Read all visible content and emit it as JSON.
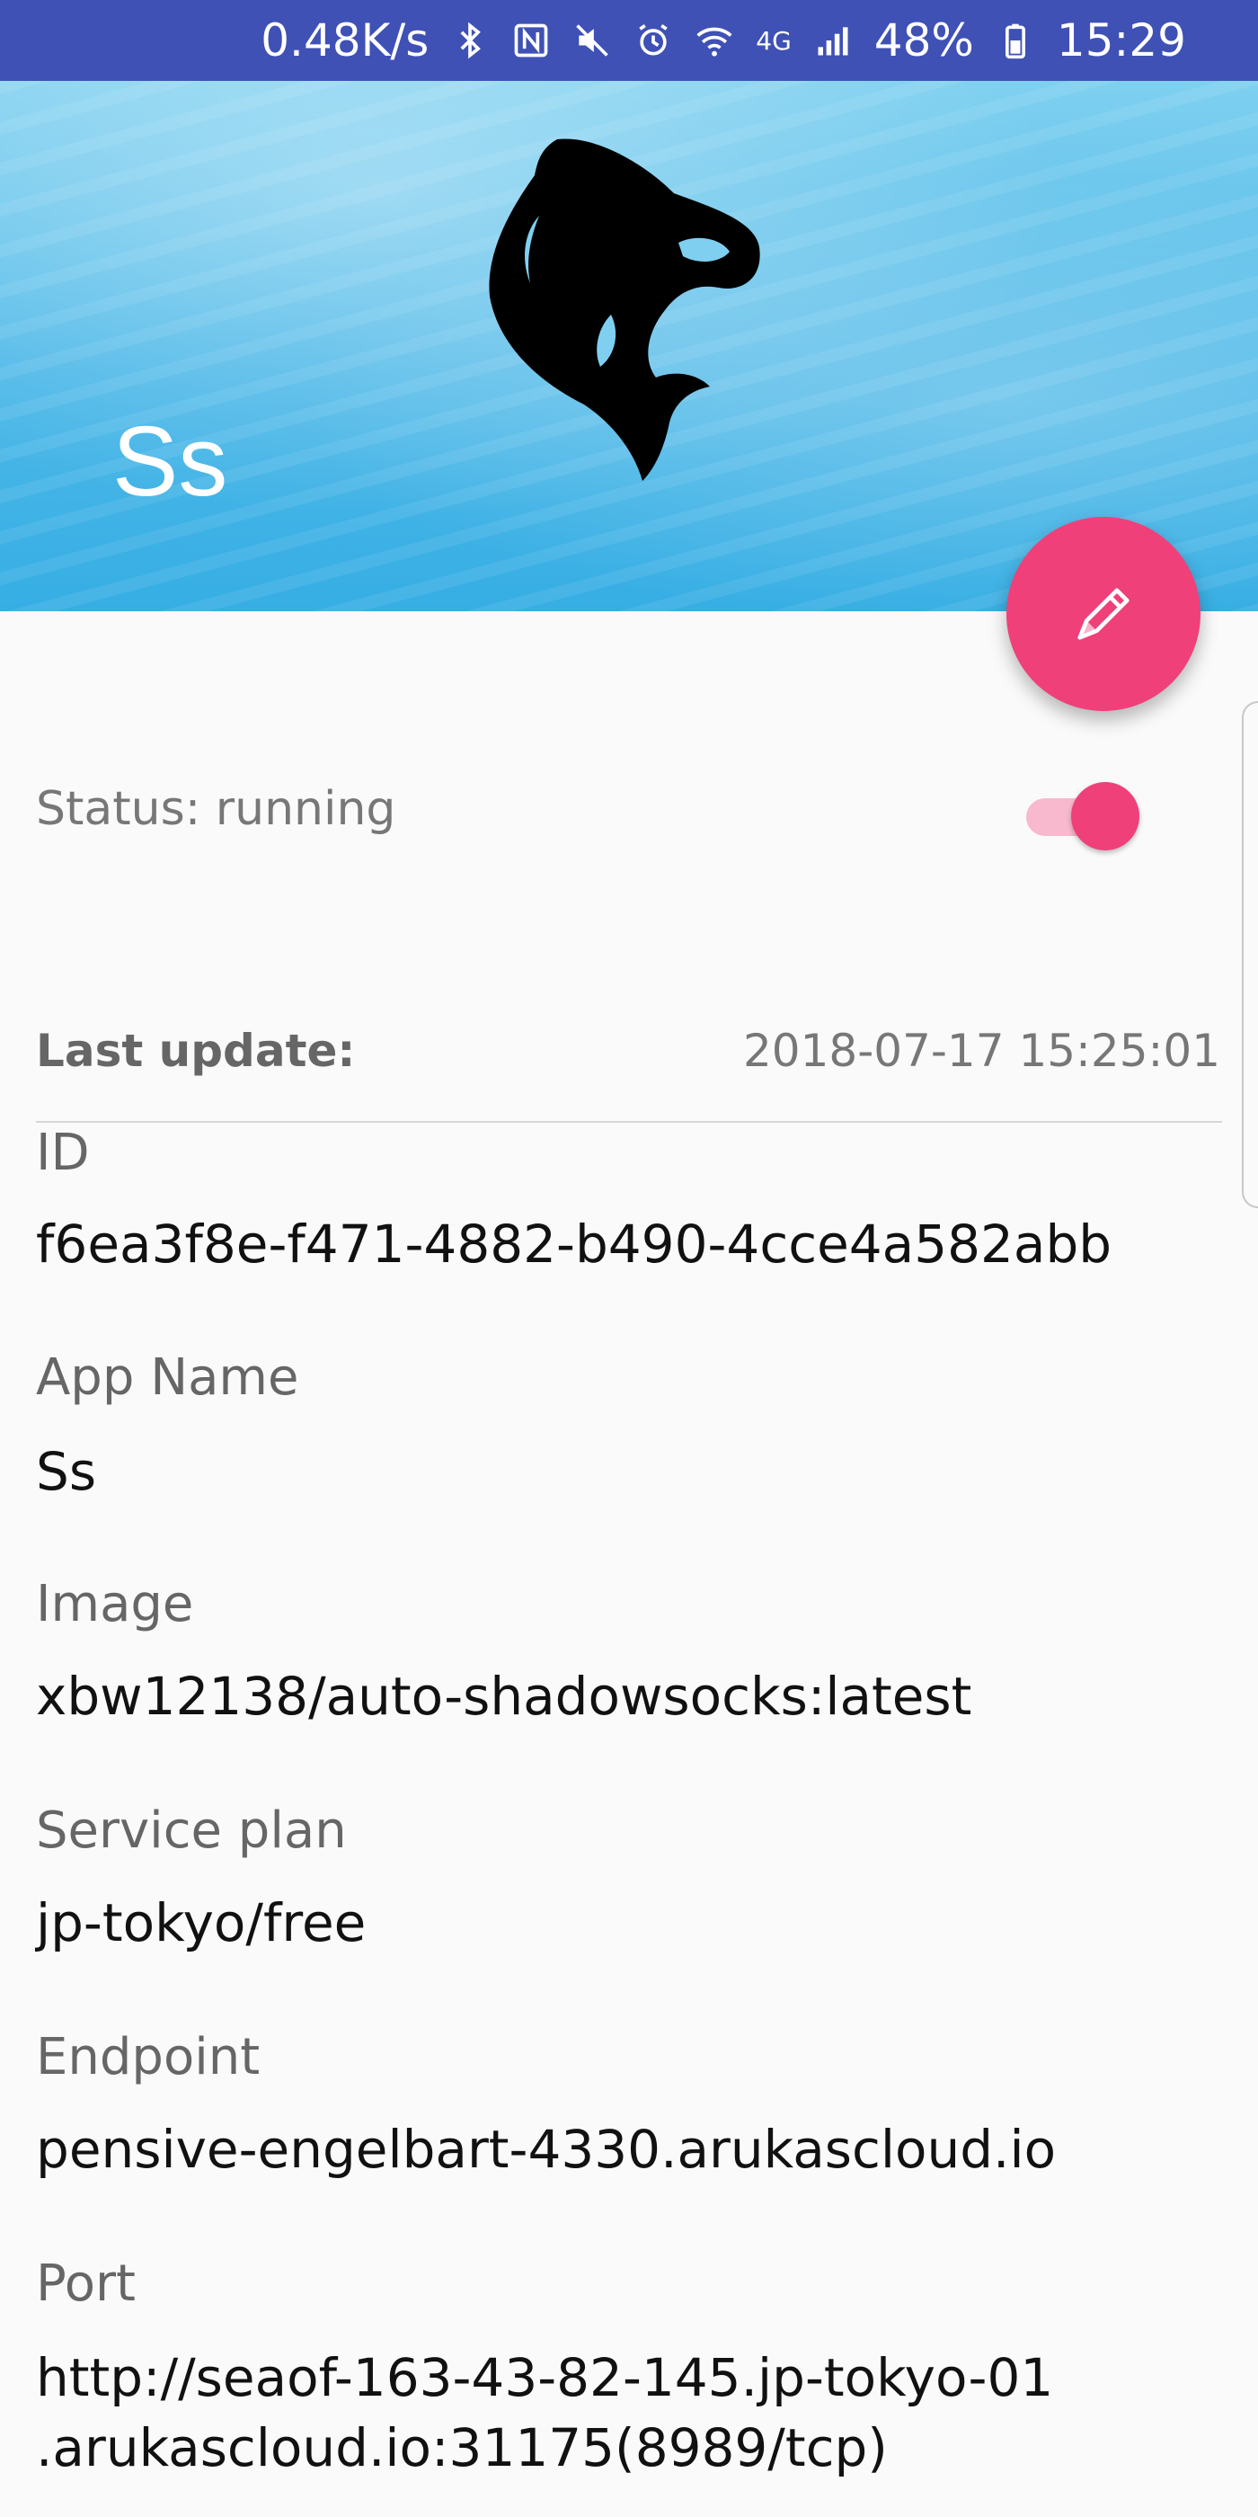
{
  "status_bar": {
    "speed": "0.48K/s",
    "network": "4G",
    "battery": "48%",
    "time": "15:29"
  },
  "header": {
    "title": "Ss",
    "logo": "orca-logo"
  },
  "fab": {
    "icon": "pencil-icon",
    "color": "#ef407a"
  },
  "status": {
    "label": "Status: running",
    "toggle_on": true
  },
  "last_update": {
    "label": "Last update:",
    "value": "2018-07-17 15:25:01"
  },
  "fields": {
    "id": {
      "label": "ID",
      "value": "f6ea3f8e-f471-4882-b490-4cce4a582abb"
    },
    "app_name": {
      "label": "App Name",
      "value": "Ss"
    },
    "image": {
      "label": "Image",
      "value": "xbw12138/auto-shadowsocks:latest"
    },
    "service_plan": {
      "label": "Service plan",
      "value": "jp-tokyo/free"
    },
    "endpoint": {
      "label": "Endpoint",
      "value": "pensive-engelbart-4330.arukascloud.io"
    },
    "port": {
      "label": "Port",
      "value_line1": "http://seaof-163-43-82-145.jp-tokyo-01",
      "value_line2": ".arukascloud.io:31175(8989/tcp)"
    }
  },
  "colors": {
    "status_bar": "#3f51b5",
    "accent": "#ef407a"
  }
}
